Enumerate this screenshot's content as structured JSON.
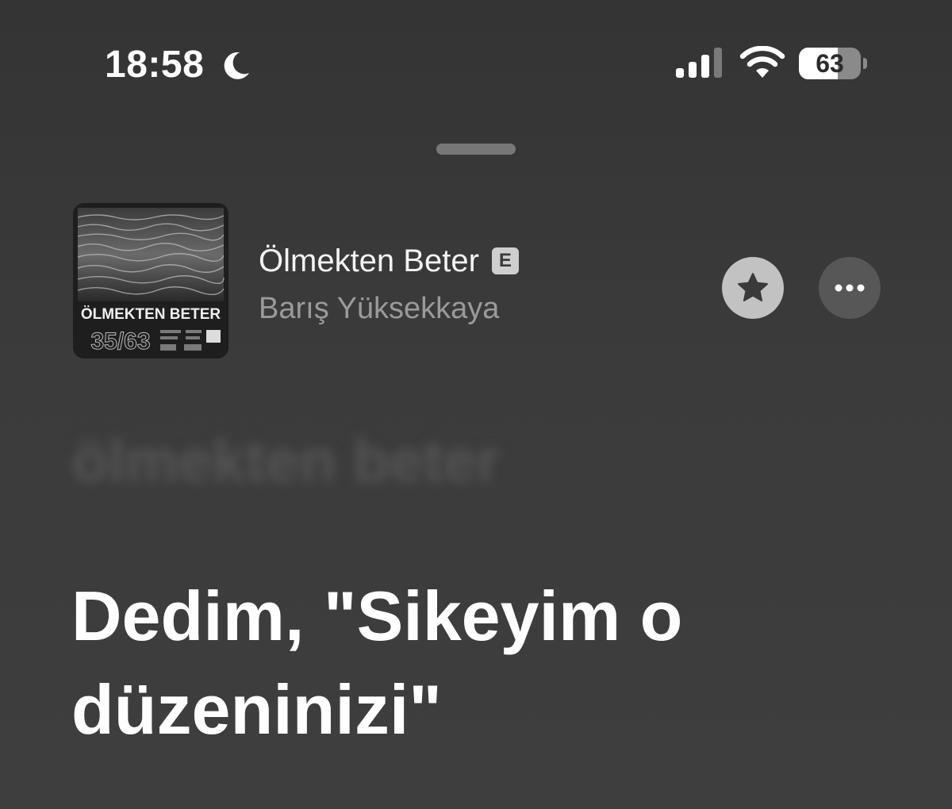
{
  "status_bar": {
    "time": "18:58",
    "battery_level": "63",
    "battery_fraction": 0.63,
    "icons": [
      "moon-icon",
      "cellular-signal-icon",
      "wifi-icon",
      "battery-icon"
    ]
  },
  "now_playing": {
    "track_title": "Ölmekten Beter",
    "explicit_label": "E",
    "artist": "Barış Yüksekkaya",
    "favorite_icon": "star-icon",
    "more_icon": "ellipsis-icon"
  },
  "album_art": {
    "title_text": "ÖLMEKTEN BETER",
    "number_text": "35/63"
  },
  "lyrics": {
    "previous_line": "ölmekten beter",
    "current_line": "Dedim, \"Sikeyim o düzeninizi\""
  },
  "colors": {
    "background": "#3a3a3a",
    "primary_text": "#ffffff",
    "secondary_text": "#9a9a9a",
    "favorite_button": "#c2c2c2",
    "more_button": "#575757"
  }
}
